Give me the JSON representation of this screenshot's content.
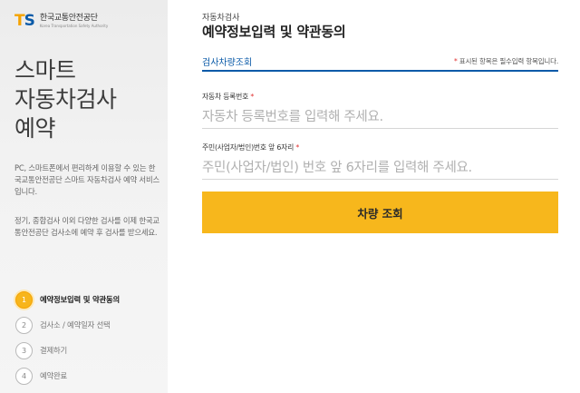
{
  "logo": {
    "mark_t": "T",
    "mark_s": "S",
    "name_ko": "한국교통안전공단",
    "name_en": "Korea Transportation Safety Authority"
  },
  "sidebar": {
    "hero_lines": [
      "스마트",
      "자동차검사",
      "예약"
    ],
    "description_1": "PC, 스마트폰에서 편리하게 이용할 수 있는 한국교통안전공단 스마트 자동차검사 예약 서비스입니다.",
    "description_2": "정기, 종합검사 이외 다양한 검사를 이제 한국교통안전공단 검사소에 예약 후 검사를 받으세요.",
    "steps": [
      {
        "num": "1",
        "label": "예약정보입력 및 약관동의",
        "active": true
      },
      {
        "num": "2",
        "label": "검사소 / 예약일자 선택",
        "active": false
      },
      {
        "num": "3",
        "label": "결제하기",
        "active": false
      },
      {
        "num": "4",
        "label": "예약완료",
        "active": false
      }
    ]
  },
  "main": {
    "breadcrumb": "자동차검사",
    "title": "예약정보입력 및 약관동의",
    "tab": "검사차량조회",
    "required_star": "*",
    "required_note": " 표시된 항목은 필수입력 항목입니다.",
    "fields": [
      {
        "label": "자동차 등록번호",
        "placeholder": "자동차 등록번호를 입력해 주세요.",
        "value": ""
      },
      {
        "label": "주민(사업자/법인)번호 앞 6자리",
        "placeholder": "주민(사업자/법인) 번호 앞 6자리를 입력해 주세요.",
        "value": ""
      }
    ],
    "submit_label": "차량 조회"
  },
  "colors": {
    "accent_yellow": "#f7b71c",
    "brand_blue": "#0a5aa8",
    "required_red": "#e03030"
  }
}
